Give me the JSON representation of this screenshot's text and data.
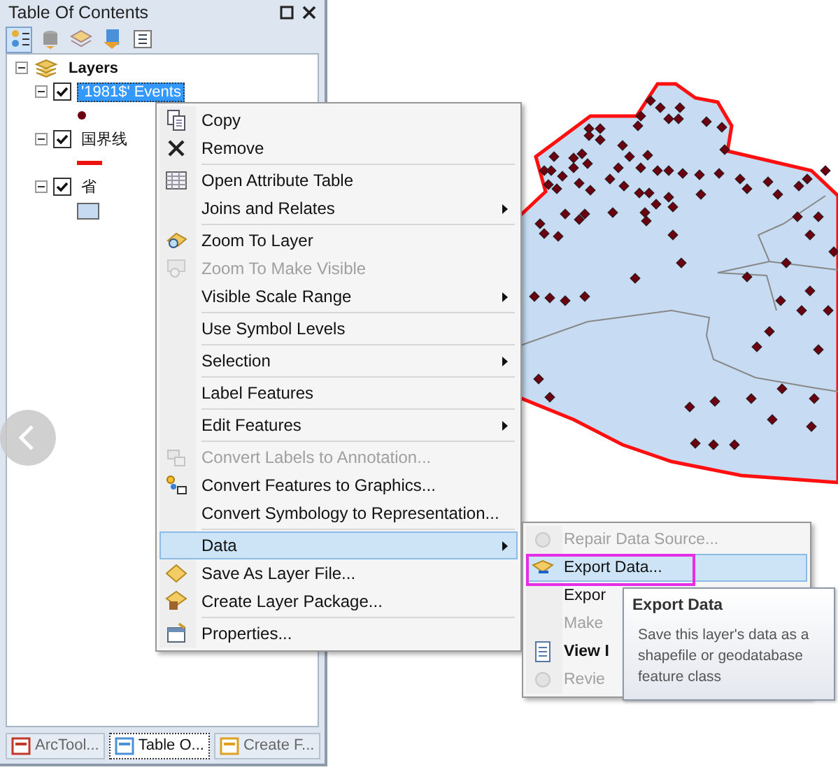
{
  "panel": {
    "title": "Table Of Contents",
    "toolbar": [
      {
        "selected": true
      },
      {
        "selected": false
      },
      {
        "selected": false
      },
      {
        "selected": false
      },
      {
        "selected": false
      }
    ],
    "tree": {
      "label": "Layers",
      "expanded": true,
      "children": [
        {
          "label": "'1981$' Events",
          "checked": true,
          "expanded": true,
          "selected": true
        },
        {
          "label": "国界线",
          "checked": true,
          "expanded": true,
          "selected": false
        },
        {
          "label": "省",
          "checked": true,
          "expanded": true,
          "selected": false
        }
      ]
    },
    "bottom_tabs": [
      {
        "label": "ArcTool...",
        "selected": false
      },
      {
        "label": "Table O...",
        "selected": true
      },
      {
        "label": "Create F...",
        "selected": false
      }
    ]
  },
  "context_menu": {
    "groups": [
      [
        {
          "label": "Copy",
          "disabled": false,
          "submenu": false,
          "selected": false
        },
        {
          "label": "Remove",
          "disabled": false,
          "submenu": false,
          "selected": false
        }
      ],
      [
        {
          "label": "Open Attribute Table",
          "disabled": false,
          "submenu": false,
          "selected": false
        },
        {
          "label": "Joins and Relates",
          "disabled": false,
          "submenu": true,
          "selected": false
        }
      ],
      [
        {
          "label": "Zoom To Layer",
          "disabled": false,
          "submenu": false,
          "selected": false
        },
        {
          "label": "Zoom To Make Visible",
          "disabled": true,
          "submenu": false,
          "selected": false
        },
        {
          "label": "Visible Scale Range",
          "disabled": false,
          "submenu": true,
          "selected": false
        }
      ],
      [
        {
          "label": "Use Symbol Levels",
          "disabled": false,
          "submenu": false,
          "selected": false
        }
      ],
      [
        {
          "label": "Selection",
          "disabled": false,
          "submenu": true,
          "selected": false
        }
      ],
      [
        {
          "label": "Label Features",
          "disabled": false,
          "submenu": false,
          "selected": false
        }
      ],
      [
        {
          "label": "Edit Features",
          "disabled": false,
          "submenu": true,
          "selected": false
        }
      ],
      [
        {
          "label": "Convert Labels to Annotation...",
          "disabled": true,
          "submenu": false,
          "selected": false
        },
        {
          "label": "Convert Features to Graphics...",
          "disabled": false,
          "submenu": false,
          "selected": false
        },
        {
          "label": "Convert Symbology to Representation...",
          "disabled": false,
          "submenu": false,
          "selected": false
        }
      ],
      [
        {
          "label": "Data",
          "disabled": false,
          "submenu": true,
          "selected": true
        },
        {
          "label": "Save As Layer File...",
          "disabled": false,
          "submenu": false,
          "selected": false
        },
        {
          "label": "Create Layer Package...",
          "disabled": false,
          "submenu": false,
          "selected": false
        }
      ],
      [
        {
          "label": "Properties...",
          "disabled": false,
          "submenu": false,
          "selected": false
        }
      ]
    ]
  },
  "submenu": {
    "items": [
      {
        "label": "Repair Data Source...",
        "disabled": true,
        "selected": false,
        "bold": false
      },
      {
        "label": "Export Data...",
        "disabled": false,
        "selected": true,
        "bold": false
      },
      {
        "label": "Expor",
        "disabled": false,
        "selected": false,
        "bold": false
      },
      {
        "label": "Make",
        "disabled": true,
        "selected": false,
        "bold": false
      },
      {
        "label": "View I",
        "disabled": false,
        "selected": false,
        "bold": true
      },
      {
        "label": "Revie",
        "disabled": true,
        "selected": false,
        "bold": false
      }
    ]
  },
  "tooltip": {
    "title": "Export Data",
    "text": "Save this layer's data as a shapefile or geodatabase feature class"
  }
}
